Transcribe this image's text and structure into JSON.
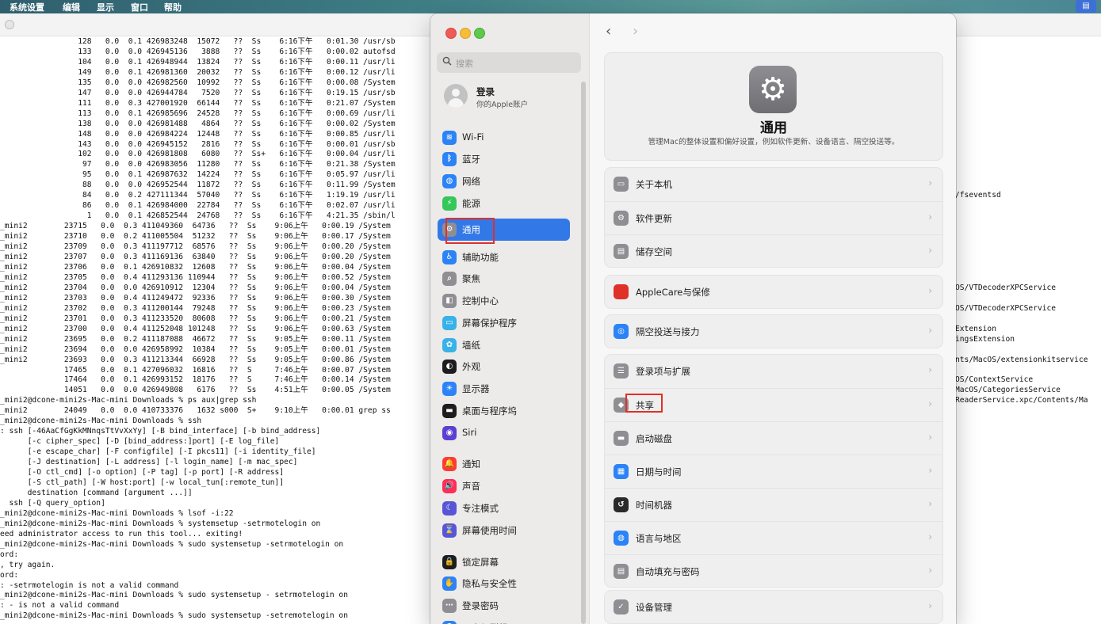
{
  "menubar": {
    "items": [
      "系统设置",
      "编辑",
      "显示",
      "窗口",
      "帮助"
    ],
    "status_icon": "display-icon"
  },
  "terminal": {
    "lines": [
      "                 128   0.0  0.1 426983248  15072   ??  Ss    6:16下午   0:01.30 /usr/sb",
      "                 133   0.0  0.0 426945136   3888   ??  Ss    6:16下午   0:00.02 autofsd",
      "                 104   0.0  0.1 426948944  13824   ??  Ss    6:16下午   0:00.11 /usr/li",
      "                 149   0.0  0.1 426981360  20032   ??  Ss    6:16下午   0:00.12 /usr/li",
      "                 135   0.0  0.0 426982560  10992   ??  Ss    6:16下午   0:00.08 /System",
      "                 147   0.0  0.0 426944784   7520   ??  Ss    6:16下午   0:19.15 /usr/sb",
      "                 111   0.0  0.3 427001920  66144   ??  Ss    6:16下午   0:21.07 /System",
      "                 113   0.0  0.1 426985696  24528   ??  Ss    6:16下午   0:00.69 /usr/li",
      "                 138   0.0  0.0 426981488   4864   ??  Ss    6:16下午   0:00.02 /System",
      "                 148   0.0  0.0 426984224  12448   ??  Ss    6:16下午   0:00.85 /usr/li",
      "                 143   0.0  0.0 426945152   2816   ??  Ss    6:16下午   0:00.01 /usr/sb",
      "                 102   0.0  0.0 426981808   6080   ??  Ss+   6:16下午   0:00.04 /usr/li",
      "                  97   0.0  0.0 426983056  11280   ??  Ss    6:16下午   0:21.38 /System",
      "                  95   0.0  0.1 426987632  14224   ??  Ss    6:16下午   0:05.97 /usr/li",
      "                  88   0.0  0.0 426952544  11872   ??  Ss    6:16下午   0:11.99 /System",
      "                  84   0.0  0.2 427111344  57040   ??  Ss    6:16下午   1:19.19 /usr/li",
      "                  86   0.0  0.1 426984000  22784   ??  Ss    6:16下午   0:02.07 /usr/li",
      "                   1   0.0  0.1 426852544  24768   ??  Ss    6:16下午   4:21.35 /sbin/l",
      "_mini2        23715   0.0  0.3 411049360  64736   ??  Ss    9:06上午   0:00.19 /System",
      "_mini2        23710   0.0  0.2 411005504  51232   ??  Ss    9:06上午   0:00.17 /System",
      "_mini2        23709   0.0  0.3 411197712  68576   ??  Ss    9:06上午   0:00.20 /System",
      "_mini2        23707   0.0  0.3 411169136  63840   ??  Ss    9:06上午   0:00.20 /System",
      "_mini2        23706   0.0  0.1 426910832  12608   ??  Ss    9:06上午   0:00.04 /System",
      "_mini2        23705   0.0  0.4 411293136 110944   ??  Ss    9:06上午   0:00.52 /System",
      "_mini2        23704   0.0  0.0 426910912  12304   ??  Ss    9:06上午   0:00.04 /System",
      "_mini2        23703   0.0  0.4 411249472  92336   ??  Ss    9:06上午   0:00.30 /System",
      "_mini2        23702   0.0  0.3 411200144  79248   ??  Ss    9:06上午   0:00.23 /System",
      "_mini2        23701   0.0  0.3 411233520  80608   ??  Ss    9:06上午   0:00.21 /System",
      "_mini2        23700   0.0  0.4 411252048 101248   ??  Ss    9:06上午   0:00.63 /System",
      "_mini2        23695   0.0  0.2 411187088  46672   ??  Ss    9:05上午   0:00.11 /System",
      "_mini2        23694   0.0  0.0 426958992  10384   ??  Ss    9:05上午   0:00.01 /System",
      "_mini2        23693   0.0  0.3 411213344  66928   ??  Ss    9:05上午   0:00.86 /System",
      "              17465   0.0  0.1 427096032  16816   ??  S     7:46上午   0:00.07 /System",
      "              17464   0.0  0.1 426993152  18176   ??  S     7:46上午   0:00.14 /System",
      "              14051   0.0  0.0 426949808   6176   ??  Ss    4:51上午   0:00.05 /System",
      "_mini2@dcone-mini2s-Mac-mini Downloads % ps aux|grep ssh",
      "_mini2        24049   0.0  0.0 410733376   1632 s000  S+    9:10上午   0:00.01 grep ss",
      "_mini2@dcone-mini2s-Mac-mini Downloads % ssh",
      ": ssh [-46AaCfGgKkMNnqsTtVvXxYy] [-B bind_interface] [-b bind_address]",
      "      [-c cipher_spec] [-D [bind_address:]port] [-E log_file]",
      "      [-e escape_char] [-F configfile] [-I pkcs11] [-i identity_file]",
      "      [-J destination] [-L address] [-l login_name] [-m mac_spec]",
      "      [-O ctl_cmd] [-o option] [-P tag] [-p port] [-R address]",
      "      [-S ctl_path] [-W host:port] [-w local_tun[:remote_tun]]",
      "      destination [command [argument ...]]",
      "  ssh [-Q query_option]",
      "_mini2@dcone-mini2s-Mac-mini Downloads % lsof -i:22",
      "_mini2@dcone-mini2s-Mac-mini Downloads % systemsetup -setrmotelogin on",
      "eed administrator access to run this tool... exiting!",
      "_mini2@dcone-mini2s-Mac-mini Downloads % sudo systemsetup -setrmotelogin on",
      "ord:",
      ", try again.",
      "ord:",
      ": -setrmotelogin is not a valid command",
      "_mini2@dcone-mini2s-Mac-mini Downloads % sudo systemsetup - setrmotelogin on",
      ": - is not a valid command",
      "_mini2@dcone-mini2s-Mac-mini Downloads % sudo systemsetup -setremotelogin on"
    ],
    "right_lines": [
      "",
      "",
      "",
      "",
      "",
      "",
      "",
      "",
      "",
      "",
      "",
      "",
      "",
      "",
      "",
      "/fseventsd",
      "",
      "",
      "",
      "",
      "",
      "",
      "",
      "",
      "OS/VTDecoderXPCService",
      "",
      "OS/VTDecoderXPCService",
      "",
      "Extension",
      "ingsExtension",
      "",
      "nts/MacOS/extensionkitservice",
      "",
      "OS/ContextService",
      "MacOS/CategoriesService",
      "ReaderService.xpc/Contents/Ma"
    ]
  },
  "settings": {
    "search_placeholder": "搜索",
    "account": {
      "name": "登录",
      "subtitle": "你的Apple账户"
    },
    "sidebar": [
      {
        "label": "Wi-Fi",
        "icon": "wifi-icon",
        "glyph": "≋",
        "color": "#2b83f6"
      },
      {
        "label": "蓝牙",
        "icon": "bluetooth-icon",
        "glyph": "ᛒ",
        "color": "#2b83f6"
      },
      {
        "label": "网络",
        "icon": "network-icon",
        "glyph": "◍",
        "color": "#2b83f6"
      },
      {
        "label": "能源",
        "icon": "battery-icon",
        "glyph": "⚡",
        "color": "#35c759"
      },
      {
        "label": "通用",
        "icon": "gear-icon",
        "glyph": "⚙",
        "color": "#8e8e93",
        "selected": true
      },
      {
        "label": "辅助功能",
        "icon": "accessibility-icon",
        "glyph": "♿",
        "color": "#2b83f6"
      },
      {
        "label": "聚焦",
        "icon": "spotlight-icon",
        "glyph": "⌕",
        "color": "#8e8e93"
      },
      {
        "label": "控制中心",
        "icon": "control-center-icon",
        "glyph": "◧",
        "color": "#8e8e93"
      },
      {
        "label": "屏幕保护程序",
        "icon": "screensaver-icon",
        "glyph": "▭",
        "color": "#38b2e8"
      },
      {
        "label": "墙纸",
        "icon": "wallpaper-icon",
        "glyph": "✿",
        "color": "#38b2e8"
      },
      {
        "label": "外观",
        "icon": "appearance-icon",
        "glyph": "◐",
        "color": "#1d1d1f"
      },
      {
        "label": "显示器",
        "icon": "display-icon",
        "glyph": "☀",
        "color": "#2b83f6"
      },
      {
        "label": "桌面与程序坞",
        "icon": "dock-icon",
        "glyph": "▬",
        "color": "#1d1d1f"
      },
      {
        "label": "Siri",
        "icon": "siri-icon",
        "glyph": "◉",
        "color": "#5d3fd3"
      },
      {
        "label": "通知",
        "icon": "notifications-icon",
        "glyph": "🔔",
        "color": "#ff3b30"
      },
      {
        "label": "声音",
        "icon": "sound-icon",
        "glyph": "🔊",
        "color": "#ff2d55"
      },
      {
        "label": "专注模式",
        "icon": "focus-icon",
        "glyph": "☾",
        "color": "#5856d6"
      },
      {
        "label": "屏幕使用时间",
        "icon": "screen-time-icon",
        "glyph": "⌛",
        "color": "#5856d6"
      },
      {
        "label": "锁定屏幕",
        "icon": "lock-icon",
        "glyph": "🔒",
        "color": "#1d1d1f"
      },
      {
        "label": "隐私与安全性",
        "icon": "privacy-icon",
        "glyph": "✋",
        "color": "#2b83f6"
      },
      {
        "label": "登录密码",
        "icon": "password-icon",
        "glyph": "⋯",
        "color": "#8e8e93"
      },
      {
        "label": "用户与群组",
        "icon": "users-icon",
        "glyph": "☻",
        "color": "#2b83f6"
      }
    ],
    "panel": {
      "title": "通用",
      "description": "管理Mac的整体设置和偏好设置，例如软件更新、设备语言、隔空投送等。",
      "groups": [
        [
          {
            "label": "关于本机",
            "icon": "about-icon",
            "glyph": "▭",
            "color": "#8e8e93"
          },
          {
            "label": "软件更新",
            "icon": "software-update-icon",
            "glyph": "⚙",
            "color": "#8e8e93"
          },
          {
            "label": "储存空间",
            "icon": "storage-icon",
            "glyph": "▤",
            "color": "#8e8e93"
          }
        ],
        [
          {
            "label": "AppleCare与保修",
            "icon": "applecare-icon",
            "glyph": "",
            "color": "#e0302a"
          }
        ],
        [
          {
            "label": "隔空投送与接力",
            "icon": "airdrop-icon",
            "glyph": "◎",
            "color": "#2b83f6"
          }
        ],
        [
          {
            "label": "登录项与扩展",
            "icon": "login-items-icon",
            "glyph": "☰",
            "color": "#8e8e93"
          },
          {
            "label": "共享",
            "icon": "sharing-icon",
            "glyph": "◆",
            "color": "#8e8e93"
          },
          {
            "label": "启动磁盘",
            "icon": "startup-disk-icon",
            "glyph": "▬",
            "color": "#8e8e93"
          },
          {
            "label": "日期与时间",
            "icon": "date-time-icon",
            "glyph": "▦",
            "color": "#2b83f6"
          },
          {
            "label": "时间机器",
            "icon": "time-machine-icon",
            "glyph": "↺",
            "color": "#2a2a2a"
          },
          {
            "label": "语言与地区",
            "icon": "language-icon",
            "glyph": "◍",
            "color": "#2b83f6"
          },
          {
            "label": "自动填充与密码",
            "icon": "autofill-icon",
            "glyph": "▤",
            "color": "#8e8e93"
          }
        ],
        [
          {
            "label": "设备管理",
            "icon": "device-management-icon",
            "glyph": "✓",
            "color": "#8e8e93"
          }
        ]
      ]
    }
  }
}
